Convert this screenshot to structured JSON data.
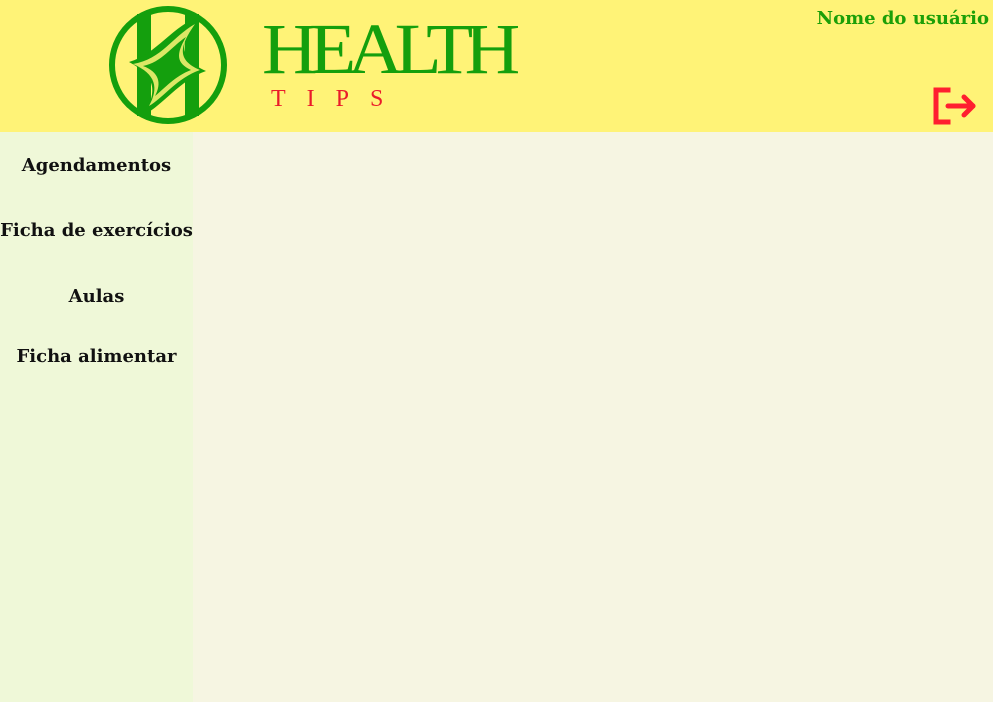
{
  "header": {
    "brand": {
      "title": "HEALTH",
      "subtitle": "TIPS"
    },
    "user_name": "Nome do usuário",
    "logout_icon": "logout-icon"
  },
  "sidebar": {
    "items": [
      {
        "label": "Agendamentos"
      },
      {
        "label": "Ficha de exercícios"
      },
      {
        "label": "Aulas"
      },
      {
        "label": "Ficha alimentar"
      }
    ]
  },
  "colors": {
    "header_background": "#fff377",
    "sidebar_background": "#eff8d8",
    "content_background": "#f6f5e2",
    "brand_green": "#149f0d",
    "brand_red": "#ea1b2a",
    "logout_red": "#ff1f2f"
  }
}
